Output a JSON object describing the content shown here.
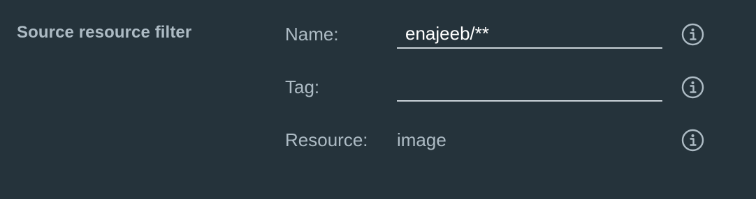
{
  "section": {
    "title": "Source resource filter"
  },
  "fields": {
    "name": {
      "label": "Name:",
      "value": "enajeeb/**",
      "placeholder": ""
    },
    "tag": {
      "label": "Tag:",
      "value": "",
      "placeholder": ""
    },
    "resource": {
      "label": "Resource:",
      "value": "image"
    }
  },
  "icons": {
    "info": "info-circle-icon"
  },
  "colors": {
    "background": "#25333b",
    "label_text": "#adbbc4",
    "input_text": "#ffffff",
    "underline": "#c9d2d8"
  }
}
